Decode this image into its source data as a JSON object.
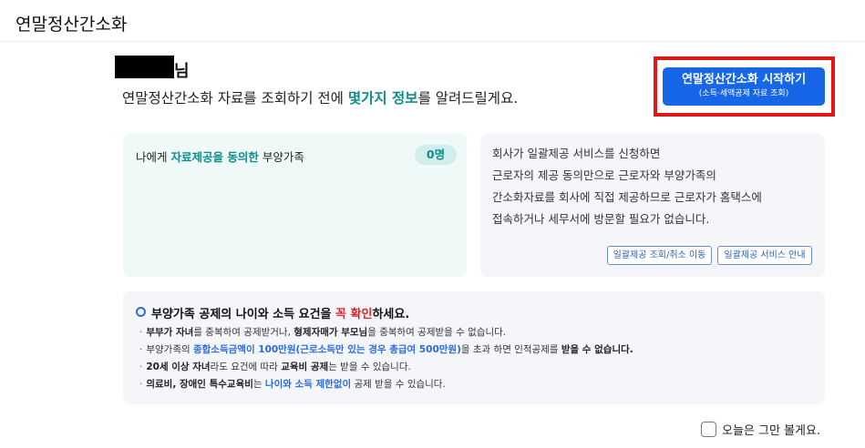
{
  "header": {
    "title": "연말정산간소화"
  },
  "greeting": {
    "name_suffix": "님",
    "intro_before": "연말정산간소화 자료를 조회하기 전에 ",
    "intro_highlight": "몇가지 정보",
    "intro_after": "를 알려드릴게요."
  },
  "start_button": {
    "label": "연말정산간소화 시작하기",
    "sublabel": "(소득·세액공제 자료 조회)"
  },
  "dependents_card": {
    "label_before": "나에게 ",
    "label_highlight": "자료제공을 동의한",
    "label_after": " 부양가족",
    "count": "0명"
  },
  "info_card": {
    "lines": [
      "회사가 일괄제공 서비스를 신청하면",
      "근로자의 제공 동의만으로 근로자와 부양가족의",
      "간소화자료를 회사에 직접 제공하므로 근로자가 홈택스에",
      "접속하거나 세무서에 방문할 필요가 없습니다."
    ],
    "btn_inquire": "일괄제공 조회/취소 이동",
    "btn_guide": "일괄제공 서비스 안내"
  },
  "notice": {
    "head_before": "부양가족 공제의 나이와 소득 요건을 ",
    "head_red": "꼭 확인",
    "head_after": "하세요.",
    "items": [
      {
        "b1": "부부가 자녀",
        "t1": "를 중복하여 공제받거나, ",
        "b2": "형제자매가 부모님",
        "t2": "을 중복하여 공제받을 수 없습니다."
      },
      {
        "t1": "부양가족의 ",
        "blue": "종합소득금액이 100만원(근로소득만 있는 경우 총급여 500만원)",
        "t2": "을 초과 하면 인적공제를 ",
        "b2": "받을 수 없습니다."
      },
      {
        "b1": "20세 이상 자녀",
        "t1": "라도 요건에 따라 ",
        "b2": "교육비 공제",
        "t2": "는 받을 수 있습니다."
      },
      {
        "b1": "의료비, 장애인 특수교육비",
        "t1": "는 ",
        "blue": "나이와 소득 제한없이",
        "t2": " 공제 받을 수 있습니다."
      }
    ]
  },
  "dismiss": {
    "label": "오늘은 그만 볼게요."
  }
}
